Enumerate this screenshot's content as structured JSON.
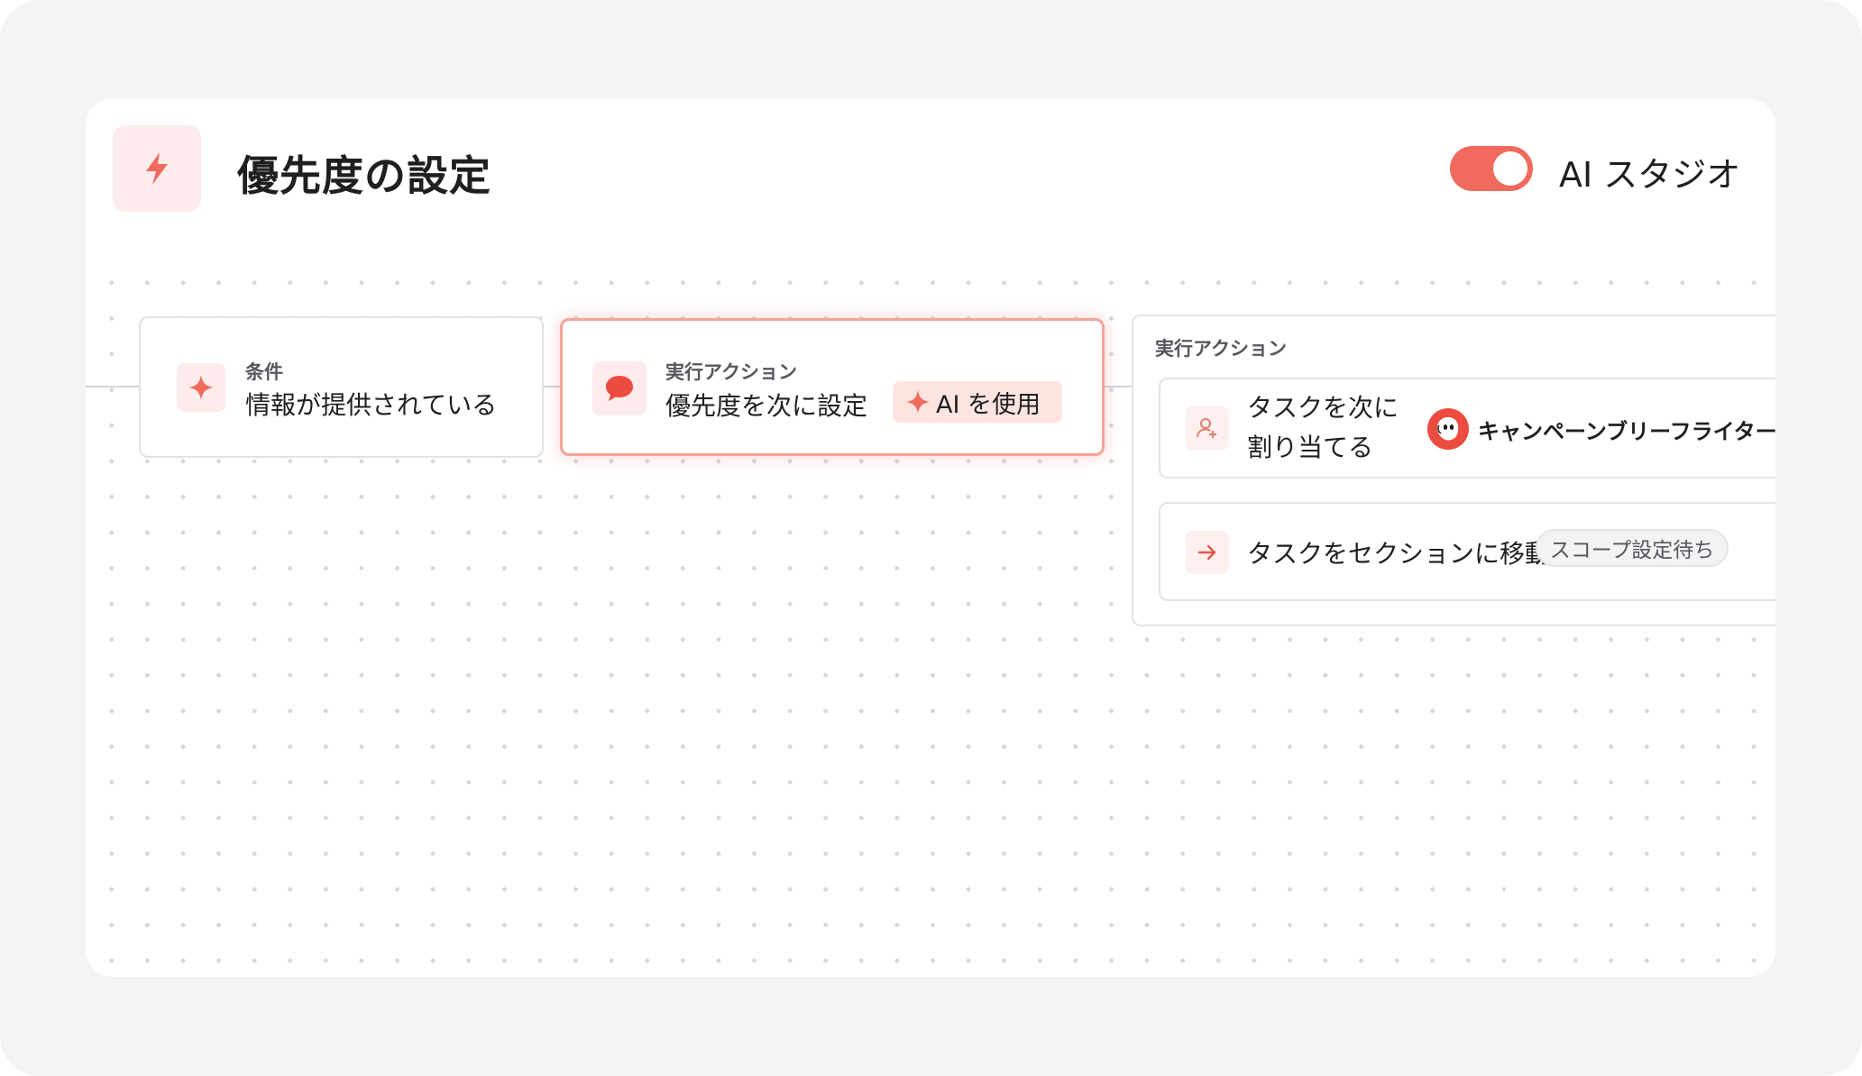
{
  "header": {
    "title": "優先度の設定",
    "icon": "lightning-icon",
    "toggle_on": true,
    "toggle_label": "AI スタジオ"
  },
  "colors": {
    "accent": "#f06a5e",
    "accent_soft": "#fdeceb",
    "border": "#e2e3e6"
  },
  "flow": {
    "condition": {
      "label": "条件",
      "text": "情報が提供されている",
      "icon": "sparkle-icon"
    },
    "action": {
      "label": "実行アクション",
      "text": "優先度を次に設定",
      "icon": "speech-bubble-icon",
      "badge": "AI を使用",
      "badge_icon": "sparkle-icon"
    },
    "action_group": {
      "label": "実行アクション",
      "assign": {
        "text_line1": "タスクを次に",
        "text_line2": "割り当てる",
        "icon": "person-add-icon",
        "assignee": "キャンペーンブリーフライター",
        "assignee_icon": "bot-avatar-icon"
      },
      "move": {
        "text": "タスクをセクションに移動",
        "icon": "arrow-right-icon",
        "status": "スコープ設定待ち"
      }
    }
  }
}
